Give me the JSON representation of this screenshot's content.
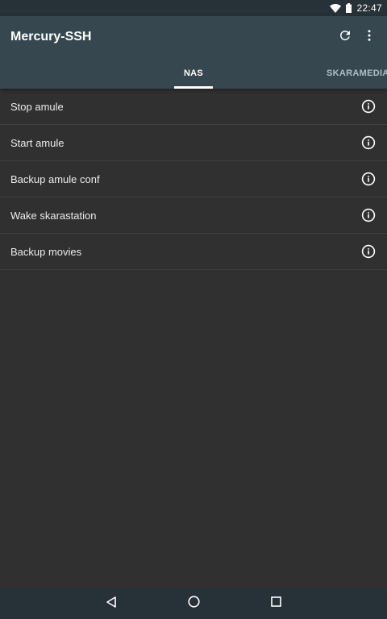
{
  "status_bar": {
    "time": "22:47",
    "icons": [
      "wifi-icon",
      "battery-icon"
    ]
  },
  "app_bar": {
    "title": "Mercury-SSH",
    "actions": [
      "refresh-icon",
      "more-vert-icon"
    ],
    "bg_color": "#37474f"
  },
  "tabs": [
    {
      "label": "NAS",
      "active": true
    },
    {
      "label": "SKARAMEDIA",
      "active": false
    }
  ],
  "commands": [
    {
      "label": "Stop amule"
    },
    {
      "label": "Start amule"
    },
    {
      "label": "Backup amule conf"
    },
    {
      "label": "Wake skarastation"
    },
    {
      "label": "Backup movies"
    }
  ],
  "nav_bar": {
    "buttons": [
      "back-icon",
      "home-icon",
      "recents-icon"
    ]
  }
}
